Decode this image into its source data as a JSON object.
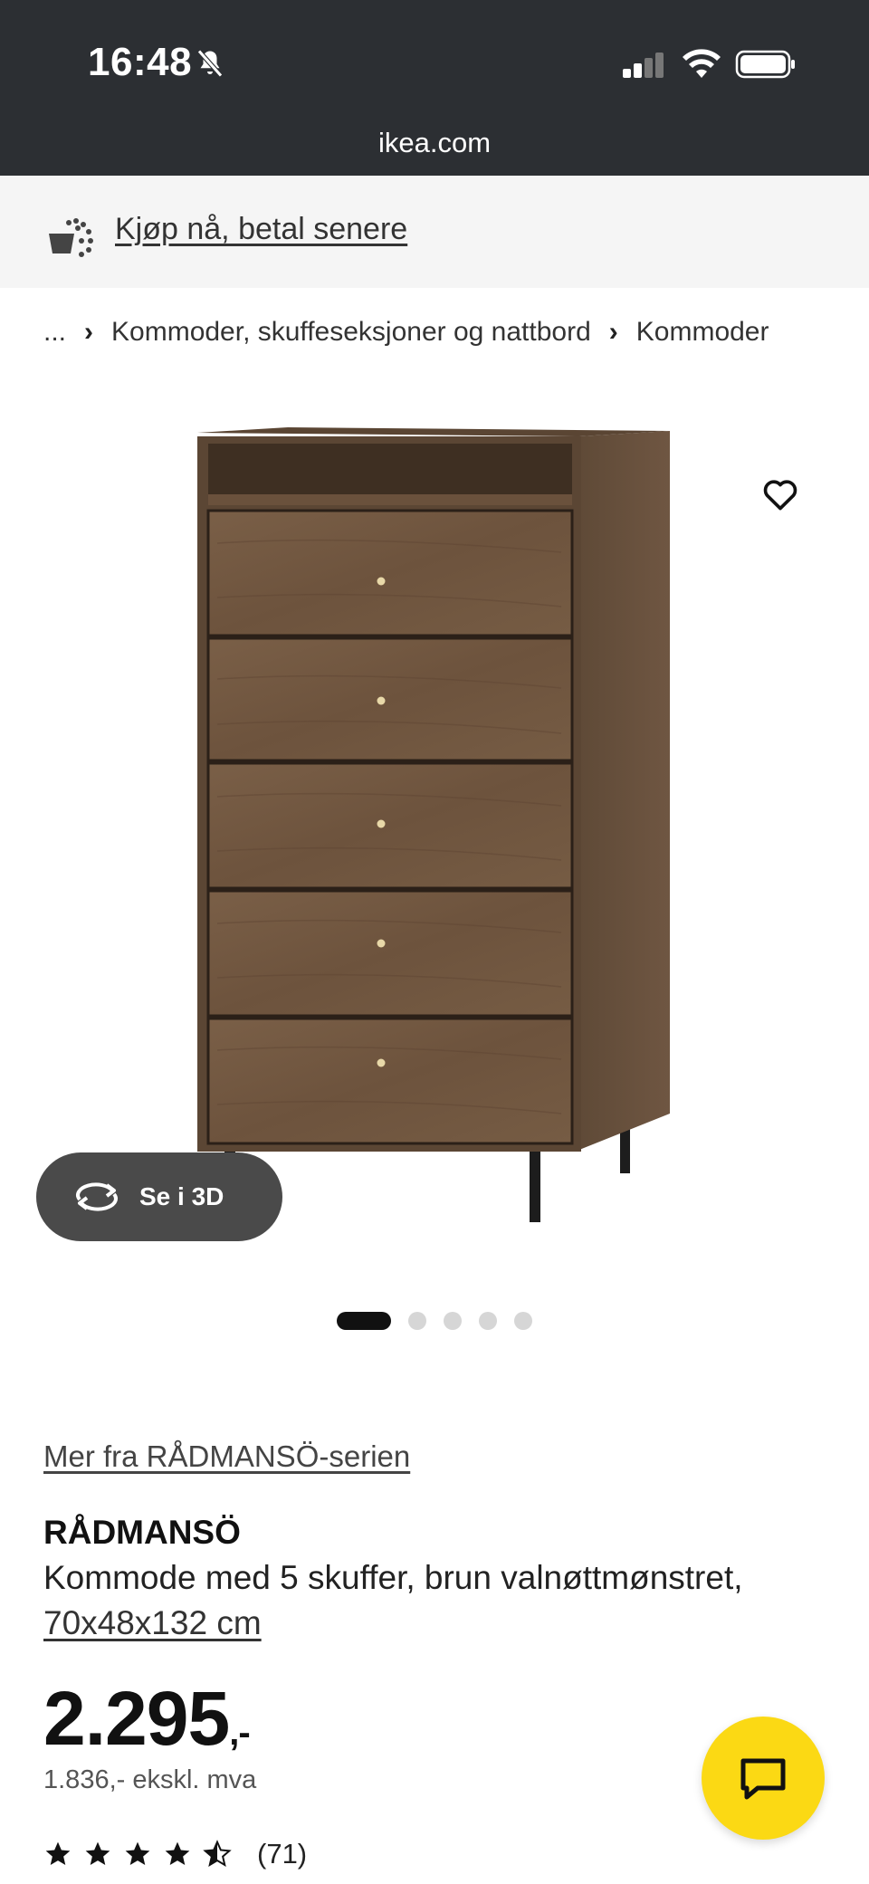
{
  "status_bar": {
    "time": "16:48",
    "url": "ikea.com"
  },
  "promo": {
    "link": "Kjøp nå, betal senere"
  },
  "breadcrumb": {
    "ellipsis": "...",
    "items": [
      "Kommoder, skuffeseksjoner og nattbord",
      "Kommoder"
    ]
  },
  "gallery": {
    "view_3d_label": "Se i 3D",
    "total_images": 5,
    "active_index": 0
  },
  "product": {
    "series_link": "Mer fra RÅDMANSÖ-serien",
    "name": "RÅDMANSÖ",
    "description": "Kommode med 5 skuffer, brun valnøttmønstret, ",
    "dimensions": "70x48x132 cm",
    "price": "2.295",
    "price_suffix": ",-",
    "price_ex_vat": "1.836,- ekskl. mva",
    "rating_value": 4.5,
    "review_count": "(71)"
  },
  "colors": {
    "header_bg": "#2c2f33",
    "chat_yellow": "#fbd914",
    "wood": "#6e5540"
  }
}
